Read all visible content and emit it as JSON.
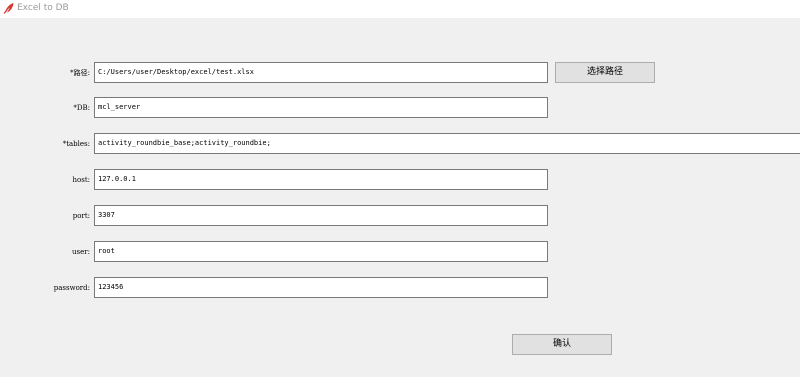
{
  "window": {
    "title": "Excel to DB"
  },
  "form": {
    "path": {
      "label": "*路径:",
      "value": "C:/Users/user/Desktop/excel/test.xlsx"
    },
    "db": {
      "label": "*DB:",
      "value": "mcl_server"
    },
    "tables": {
      "label": "*tables:",
      "value": "activity_roundbie_base;activity_roundbie;"
    },
    "host": {
      "label": "host:",
      "value": "127.0.0.1"
    },
    "port": {
      "label": "port:",
      "value": "3307"
    },
    "user": {
      "label": "user:",
      "value": "root"
    },
    "password": {
      "label": "password:",
      "value": "123456"
    }
  },
  "buttons": {
    "choose_path": "选择路径",
    "confirm": "确认"
  }
}
